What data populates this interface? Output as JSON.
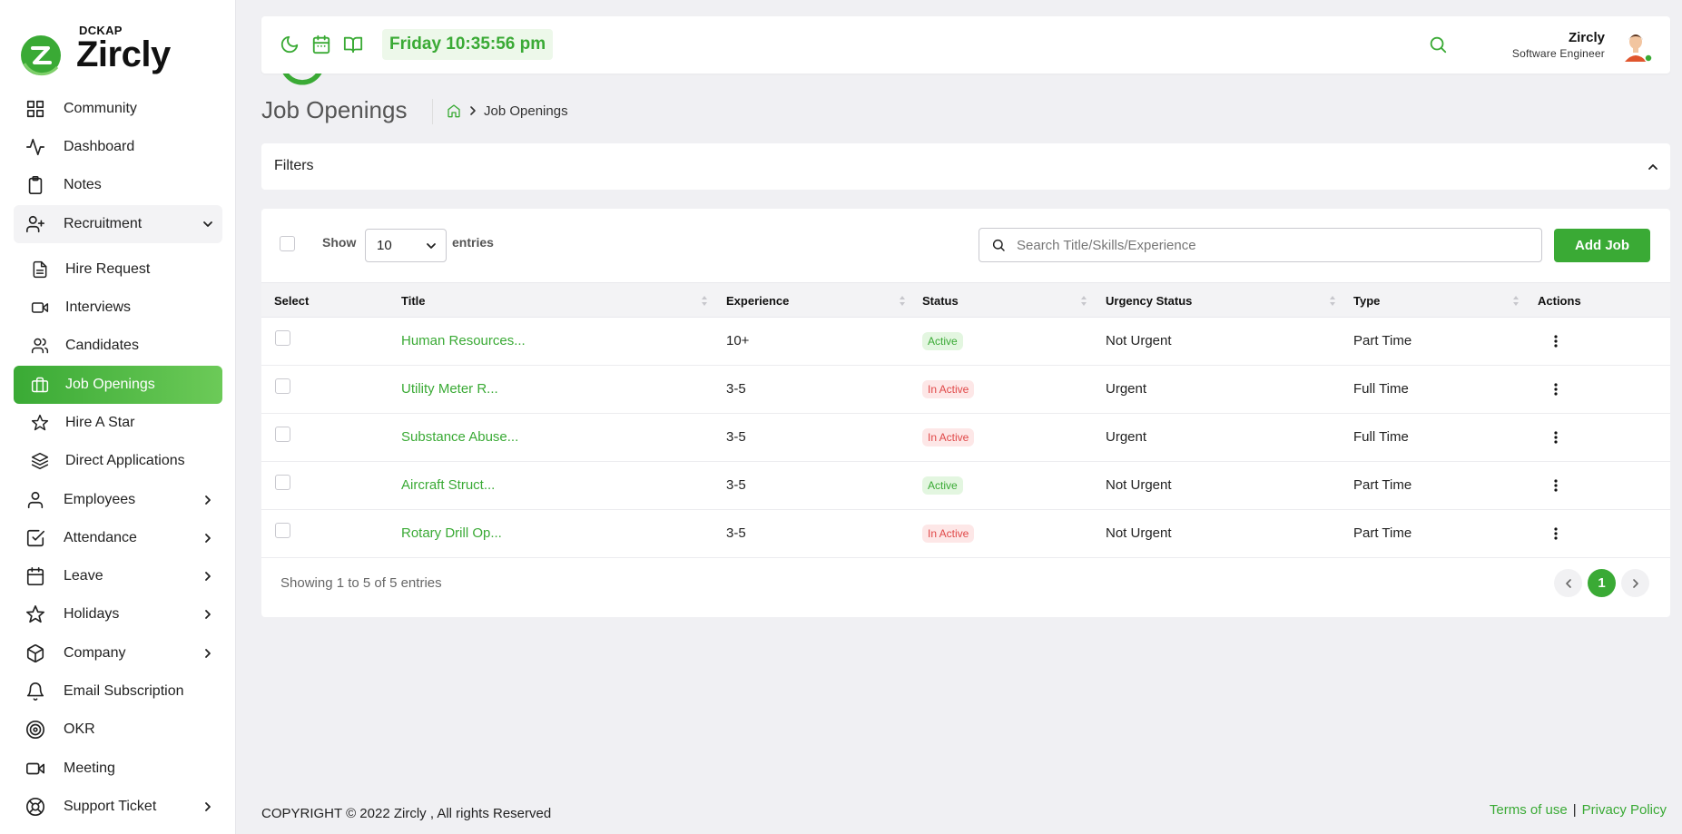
{
  "brand": {
    "company": "DCKAP",
    "name": "Zircly"
  },
  "sidebar": {
    "items": [
      {
        "label": "Community",
        "icon": "grid-icon"
      },
      {
        "label": "Dashboard",
        "icon": "activity-icon"
      },
      {
        "label": "Notes",
        "icon": "clipboard-icon"
      },
      {
        "label": "Recruitment",
        "icon": "user-plus-icon",
        "expanded": true
      },
      {
        "label": "Hire Request",
        "icon": "file-text-icon"
      },
      {
        "label": "Interviews",
        "icon": "video-icon"
      },
      {
        "label": "Candidates",
        "icon": "users-icon"
      },
      {
        "label": "Job Openings",
        "icon": "briefcase-icon",
        "active": true
      },
      {
        "label": "Hire A Star",
        "icon": "star-icon"
      },
      {
        "label": "Direct Applications",
        "icon": "layers-icon"
      },
      {
        "label": "Employees",
        "icon": "user-icon"
      },
      {
        "label": "Attendance",
        "icon": "check-square-icon"
      },
      {
        "label": "Leave",
        "icon": "calendar-icon"
      },
      {
        "label": "Holidays",
        "icon": "star-icon"
      },
      {
        "label": "Company",
        "icon": "box-icon"
      },
      {
        "label": "Email Subscription",
        "icon": "bell-icon"
      },
      {
        "label": "OKR",
        "icon": "target-icon"
      },
      {
        "label": "Meeting",
        "icon": "video-icon"
      },
      {
        "label": "Support Ticket",
        "icon": "life-buoy-icon"
      }
    ]
  },
  "topbar": {
    "clock": "Friday 10:35:56 pm",
    "user_name": "Zircly",
    "user_role": "Software Engineer"
  },
  "page": {
    "title": "Job Openings",
    "breadcrumb_current": "Job Openings"
  },
  "filters": {
    "label": "Filters"
  },
  "table": {
    "show_label": "Show",
    "entries_value": "10",
    "entries_label": "entries",
    "search_placeholder": "Search Title/Skills/Experience",
    "add_button": "Add Job",
    "headers": {
      "select": "Select",
      "title": "Title",
      "experience": "Experience",
      "status": "Status",
      "urgency": "Urgency Status",
      "type": "Type",
      "actions": "Actions"
    },
    "rows": [
      {
        "title": "Human Resources...",
        "experience": "10+",
        "status": "Active",
        "urgency": "Not Urgent",
        "type": "Part Time"
      },
      {
        "title": "Utility Meter R...",
        "experience": "3-5",
        "status": "In Active",
        "urgency": "Urgent",
        "type": "Full Time"
      },
      {
        "title": "Substance Abuse...",
        "experience": "3-5",
        "status": "In Active",
        "urgency": "Urgent",
        "type": "Full Time"
      },
      {
        "title": "Aircraft Struct...",
        "experience": "3-5",
        "status": "Active",
        "urgency": "Not Urgent",
        "type": "Part Time"
      },
      {
        "title": "Rotary Drill Op...",
        "experience": "3-5",
        "status": "In Active",
        "urgency": "Not Urgent",
        "type": "Part Time"
      }
    ],
    "showing_text": "Showing 1 to 5 of 5 entries",
    "current_page": "1"
  },
  "footer": {
    "copyright": "COPYRIGHT © 2022 Zircly , All rights Reserved",
    "terms": "Terms of use",
    "privacy": "Privacy Policy"
  },
  "colors": {
    "accent": "#3aaa35",
    "inactive": "#e04848"
  }
}
